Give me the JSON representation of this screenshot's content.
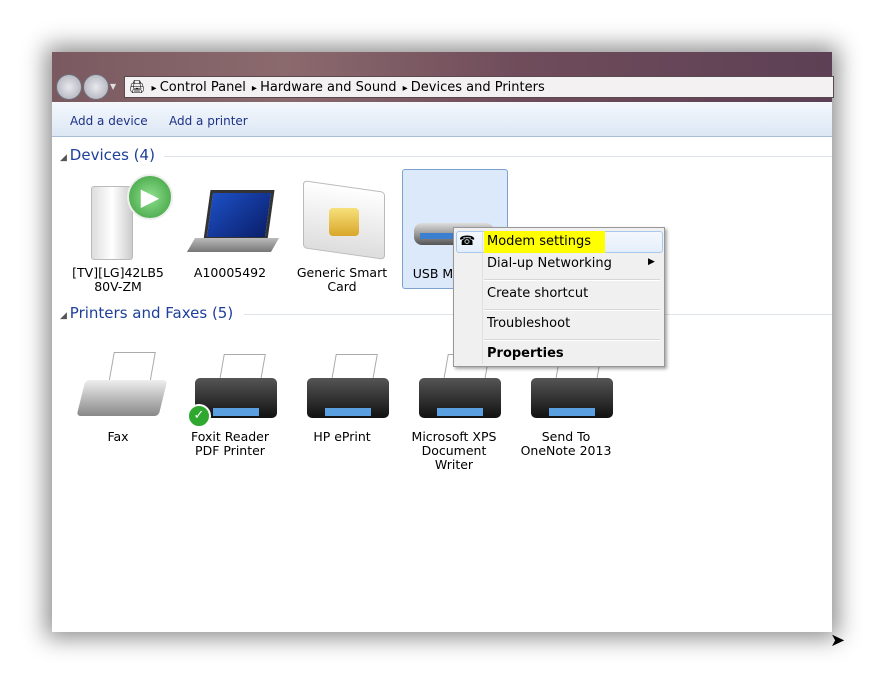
{
  "breadcrumb": [
    "Control Panel",
    "Hardware and Sound",
    "Devices and Printers"
  ],
  "toolbar": {
    "add_device": "Add a device",
    "add_printer": "Add a printer"
  },
  "devices": {
    "title": "Devices (4)",
    "items": [
      {
        "label": "[TV][LG]42LB5 80V-ZM",
        "icon": "media-device-icon"
      },
      {
        "label": "A10005492",
        "icon": "laptop-icon"
      },
      {
        "label": "Generic Smart Card",
        "icon": "smart-card-icon"
      },
      {
        "label": "USB M",
        "icon": "modem-icon"
      }
    ]
  },
  "printers": {
    "title": "Printers and Faxes (5)",
    "items": [
      {
        "label": "Fax",
        "icon": "fax-icon"
      },
      {
        "label": "Foxit Reader PDF Printer",
        "icon": "printer-icon",
        "default": true
      },
      {
        "label": "HP ePrint",
        "icon": "printer-icon"
      },
      {
        "label": "Microsoft XPS Document Writer",
        "icon": "printer-icon"
      },
      {
        "label": "Send To OneNote 2013",
        "icon": "printer-icon"
      }
    ]
  },
  "context_menu": {
    "items": [
      "Modem settings",
      "Dial-up Networking",
      "Create shortcut",
      "Troubleshoot",
      "Properties"
    ],
    "highlight_color": "#ffff00"
  }
}
